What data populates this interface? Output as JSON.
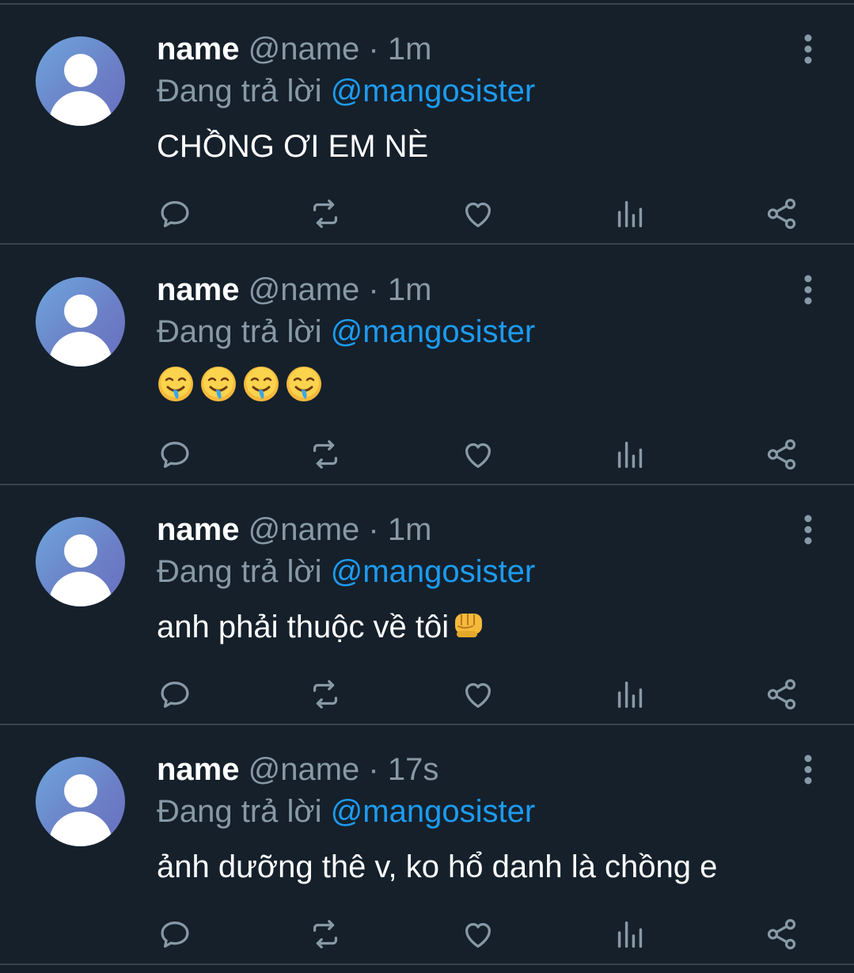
{
  "tweets": [
    {
      "name": "name",
      "handle": "@name · 1m",
      "reply_prefix": "Đang trả lời",
      "reply_to": "@mangosister",
      "text": "CHỒNG ƠI EM NÈ"
    },
    {
      "name": "name",
      "handle": "@name · 1m",
      "reply_prefix": "Đang trả lời",
      "reply_to": "@mangosister",
      "text": "",
      "emojis": [
        "drooling-face",
        "drooling-face",
        "drooling-face",
        "drooling-face"
      ]
    },
    {
      "name": "name",
      "handle": "@name · 1m",
      "reply_prefix": "Đang trả lời",
      "reply_to": "@mangosister",
      "text": "anh phải thuộc về tôi",
      "trailing_emoji": "oncoming-fist"
    },
    {
      "name": "name",
      "handle": "@name · 17s",
      "reply_prefix": "Đang trả lời",
      "reply_to": "@mangosister",
      "text": "ảnh dưỡng thê v, ko hổ danh là chồng e"
    }
  ],
  "actions": [
    "reply-icon",
    "retweet-icon",
    "like-icon",
    "analytics-icon",
    "share-icon"
  ],
  "colors": {
    "background": "#15202b",
    "divider": "#38444d",
    "muted_text": "#8899a6",
    "link": "#1d9bf0",
    "icon": "#8899a6"
  }
}
